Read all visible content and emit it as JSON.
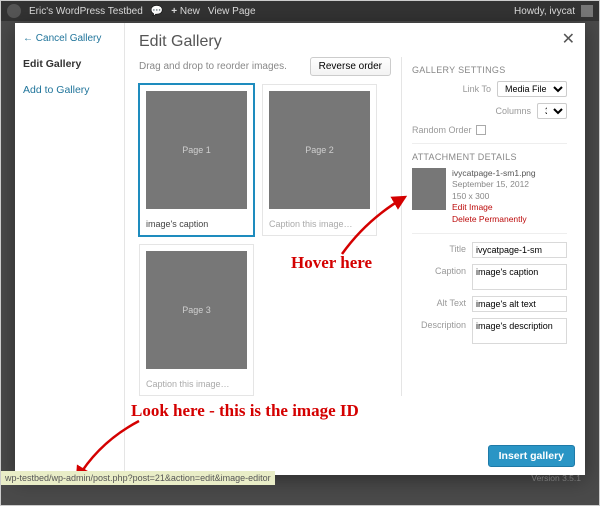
{
  "adminbar": {
    "site_title": "Eric's WordPress Testbed",
    "new_label": "New",
    "view_label": "View Page",
    "howdy": "Howdy, ivycat"
  },
  "sidebar": {
    "cancel": "Cancel Gallery",
    "edit": "Edit Gallery",
    "add": "Add to Gallery"
  },
  "header": {
    "title": "Edit Gallery",
    "hint": "Drag and drop to reorder images.",
    "reverse": "Reverse order"
  },
  "thumbs": [
    {
      "label": "Page 1",
      "caption": "image's caption",
      "placeholder": false,
      "selected": true
    },
    {
      "label": "Page 2",
      "caption": "Caption this image…",
      "placeholder": true,
      "selected": false
    },
    {
      "label": "Page 3",
      "caption": "Caption this image…",
      "placeholder": true,
      "selected": false
    }
  ],
  "settings": {
    "title": "GALLERY SETTINGS",
    "link_label": "Link To",
    "link_value": "Media File",
    "cols_label": "Columns",
    "cols_value": "3",
    "random_label": "Random Order"
  },
  "details": {
    "title": "ATTACHMENT DETAILS",
    "filename": "ivycatpage-1-sm1.png",
    "date": "September 15, 2012",
    "dims": "150 x 300",
    "edit_link": "Edit Image",
    "delete_link": "Delete Permanently"
  },
  "fields": {
    "title_label": "Title",
    "title_value": "ivycatpage-1-sm",
    "caption_label": "Caption",
    "caption_value": "image's caption",
    "alt_label": "Alt Text",
    "alt_value": "image's alt text",
    "desc_label": "Description",
    "desc_value": "image's description"
  },
  "insert_btn": "Insert gallery",
  "annotations": {
    "hover": "Hover here",
    "look": "Look here - this is the image ID"
  },
  "status_url": "wp-testbed/wp-admin/post.php?post=21&action=edit&image-editor",
  "version": "Version 3.5.1"
}
